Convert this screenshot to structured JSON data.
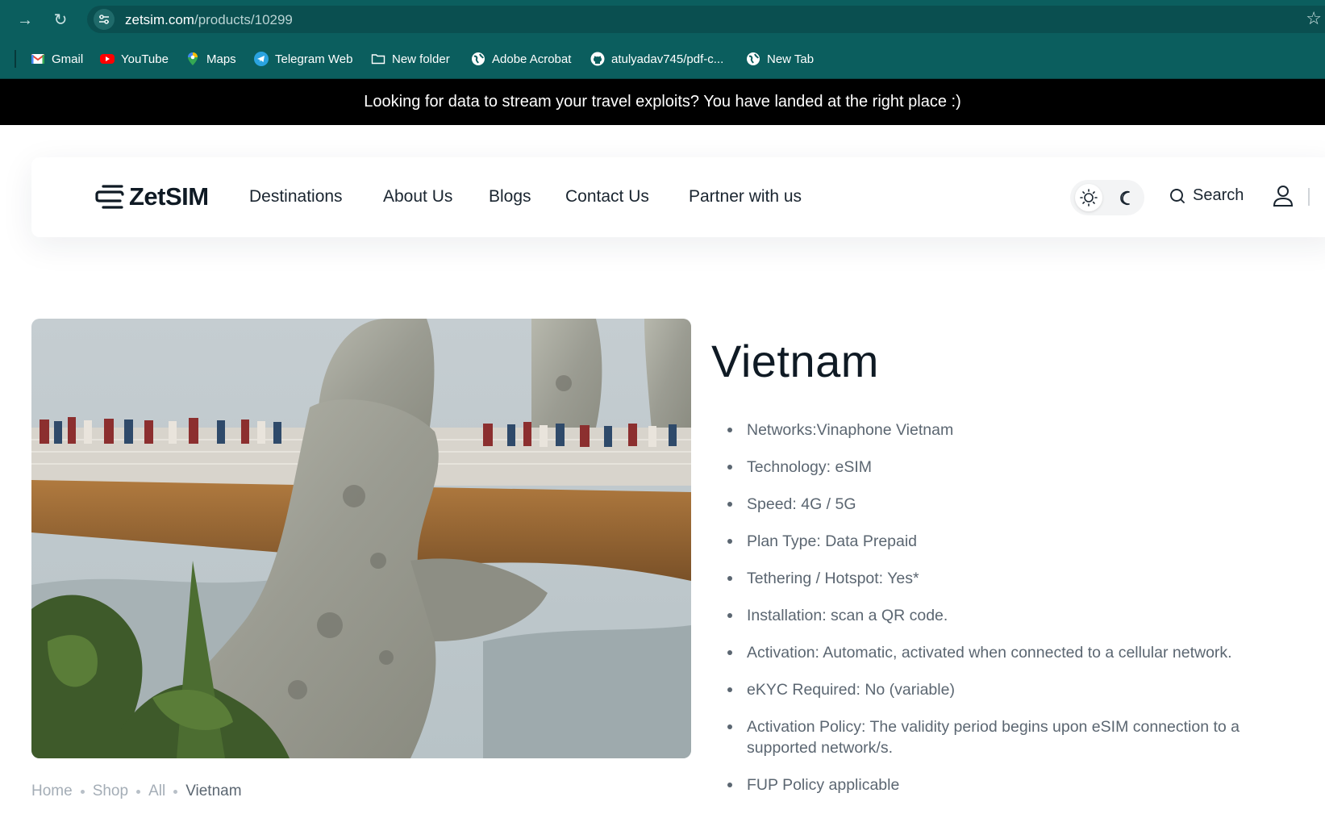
{
  "browser": {
    "url_host": "zetsim.com",
    "url_path": "/products/10299",
    "bookmarks": [
      {
        "label": "Gmail",
        "icon": "gmail-icon"
      },
      {
        "label": "YouTube",
        "icon": "youtube-icon"
      },
      {
        "label": "Maps",
        "icon": "maps-icon"
      },
      {
        "label": "Telegram Web",
        "icon": "telegram-icon"
      },
      {
        "label": "New folder",
        "icon": "folder-icon"
      },
      {
        "label": "Adobe Acrobat",
        "icon": "globe-icon"
      },
      {
        "label": "atulyadav745/pdf-c...",
        "icon": "github-icon"
      },
      {
        "label": "New Tab",
        "icon": "globe-icon"
      }
    ]
  },
  "announcement": "Looking for data to stream your travel exploits? You have landed at the right place :)",
  "header": {
    "logo_text": "ZetSIM",
    "nav": [
      "Destinations",
      "About Us",
      "Blogs",
      "Contact Us",
      "Partner with us"
    ],
    "search_label": "Search"
  },
  "product": {
    "title": "Vietnam",
    "features": [
      "Networks:Vinaphone Vietnam",
      "Technology: eSIM",
      "Speed: 4G / 5G",
      "Plan Type: Data Prepaid",
      "Tethering / Hotspot: Yes*",
      "Installation: scan a QR code.",
      "Activation: Automatic, activated when connected to a cellular network.",
      "eKYC Required: No (variable)",
      "Activation Policy: The validity period begins upon eSIM connection to a supported network/s.",
      "FUP Policy applicable"
    ]
  },
  "breadcrumb": [
    "Home",
    "Shop",
    "All",
    "Vietnam"
  ],
  "colors": {
    "browser_chrome": "#0b5e5e",
    "announcement_bg": "#000000",
    "text_muted": "#5b6671"
  }
}
